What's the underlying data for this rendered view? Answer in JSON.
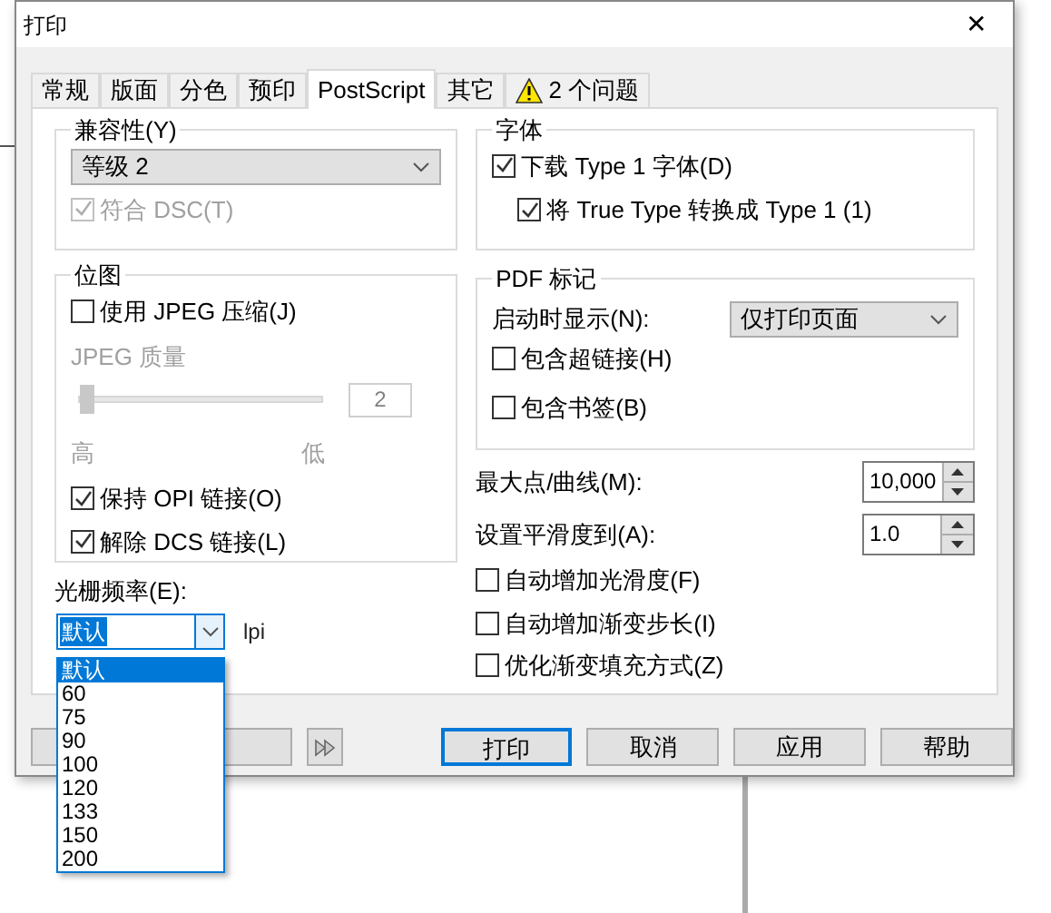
{
  "window": {
    "title": "打印",
    "close": "✕"
  },
  "tabs": [
    {
      "label": "常规",
      "selected": false
    },
    {
      "label": "版面",
      "selected": false
    },
    {
      "label": "分色",
      "selected": false
    },
    {
      "label": "预印",
      "selected": false
    },
    {
      "label": "PostScript",
      "selected": true
    },
    {
      "label": "其它",
      "selected": false
    },
    {
      "label": "2 个问题",
      "selected": false,
      "warning": true
    }
  ],
  "compatibility": {
    "title": "兼容性(Y)",
    "value": "等级 2",
    "dsc": {
      "label": "符合 DSC(T)",
      "checked": true,
      "disabled": true
    }
  },
  "bitmap": {
    "title": "位图",
    "jpeg": {
      "label": "使用 JPEG 压缩(J)",
      "checked": false
    },
    "quality_label": "JPEG 质量",
    "quality": {
      "level": 0,
      "disabled": true,
      "value": "2",
      "low_end": "高",
      "high_end": "低"
    },
    "options": [
      {
        "label": "保持 OPI 链接(O)",
        "checked": true
      },
      {
        "label": "解除 DCS 链接(L)",
        "checked": true
      }
    ]
  },
  "screen_frequency": {
    "label": "光栅频率(E):",
    "value": "默认",
    "unit": "lpi",
    "options": [
      {
        "label": "默认",
        "selected": true
      },
      {
        "label": "60",
        "selected": false
      },
      {
        "label": "75",
        "selected": false
      },
      {
        "label": "90",
        "selected": false
      },
      {
        "label": "100",
        "selected": false
      },
      {
        "label": "120",
        "selected": false
      },
      {
        "label": "133",
        "selected": false
      },
      {
        "label": "150",
        "selected": false
      },
      {
        "label": "200",
        "selected": false
      }
    ]
  },
  "fonts": {
    "title": "字体",
    "items": [
      {
        "label": "下载 Type 1 字体(D)",
        "checked": true,
        "children": [
          {
            "label": "将 True Type 转换成 Type 1 (1)",
            "checked": true
          }
        ]
      }
    ]
  },
  "pdf_marks": {
    "title": "PDF 标记",
    "startup_label": "启动时显示(N):",
    "startup_value": "仅打印页面",
    "items": [
      {
        "label": "包含超链接(H)",
        "checked": false
      },
      {
        "label": "包含书签(B)",
        "checked": false
      }
    ]
  },
  "spinners": [
    {
      "label": "最大点/曲线(M):",
      "value": "10,000"
    },
    {
      "label": "设置平滑度到(A):",
      "value": "1.0"
    }
  ],
  "options": [
    {
      "label": "自动增加光滑度(F)",
      "checked": false
    },
    {
      "label": "自动增加渐变步长(I)",
      "checked": false
    },
    {
      "label": "优化渐变填充方式(Z)",
      "checked": false
    }
  ],
  "buttons": [
    {
      "label": "打印",
      "default": true
    },
    {
      "label": "取消",
      "default": false
    },
    {
      "label": "应用",
      "default": false
    },
    {
      "label": "帮助",
      "default": false
    }
  ]
}
